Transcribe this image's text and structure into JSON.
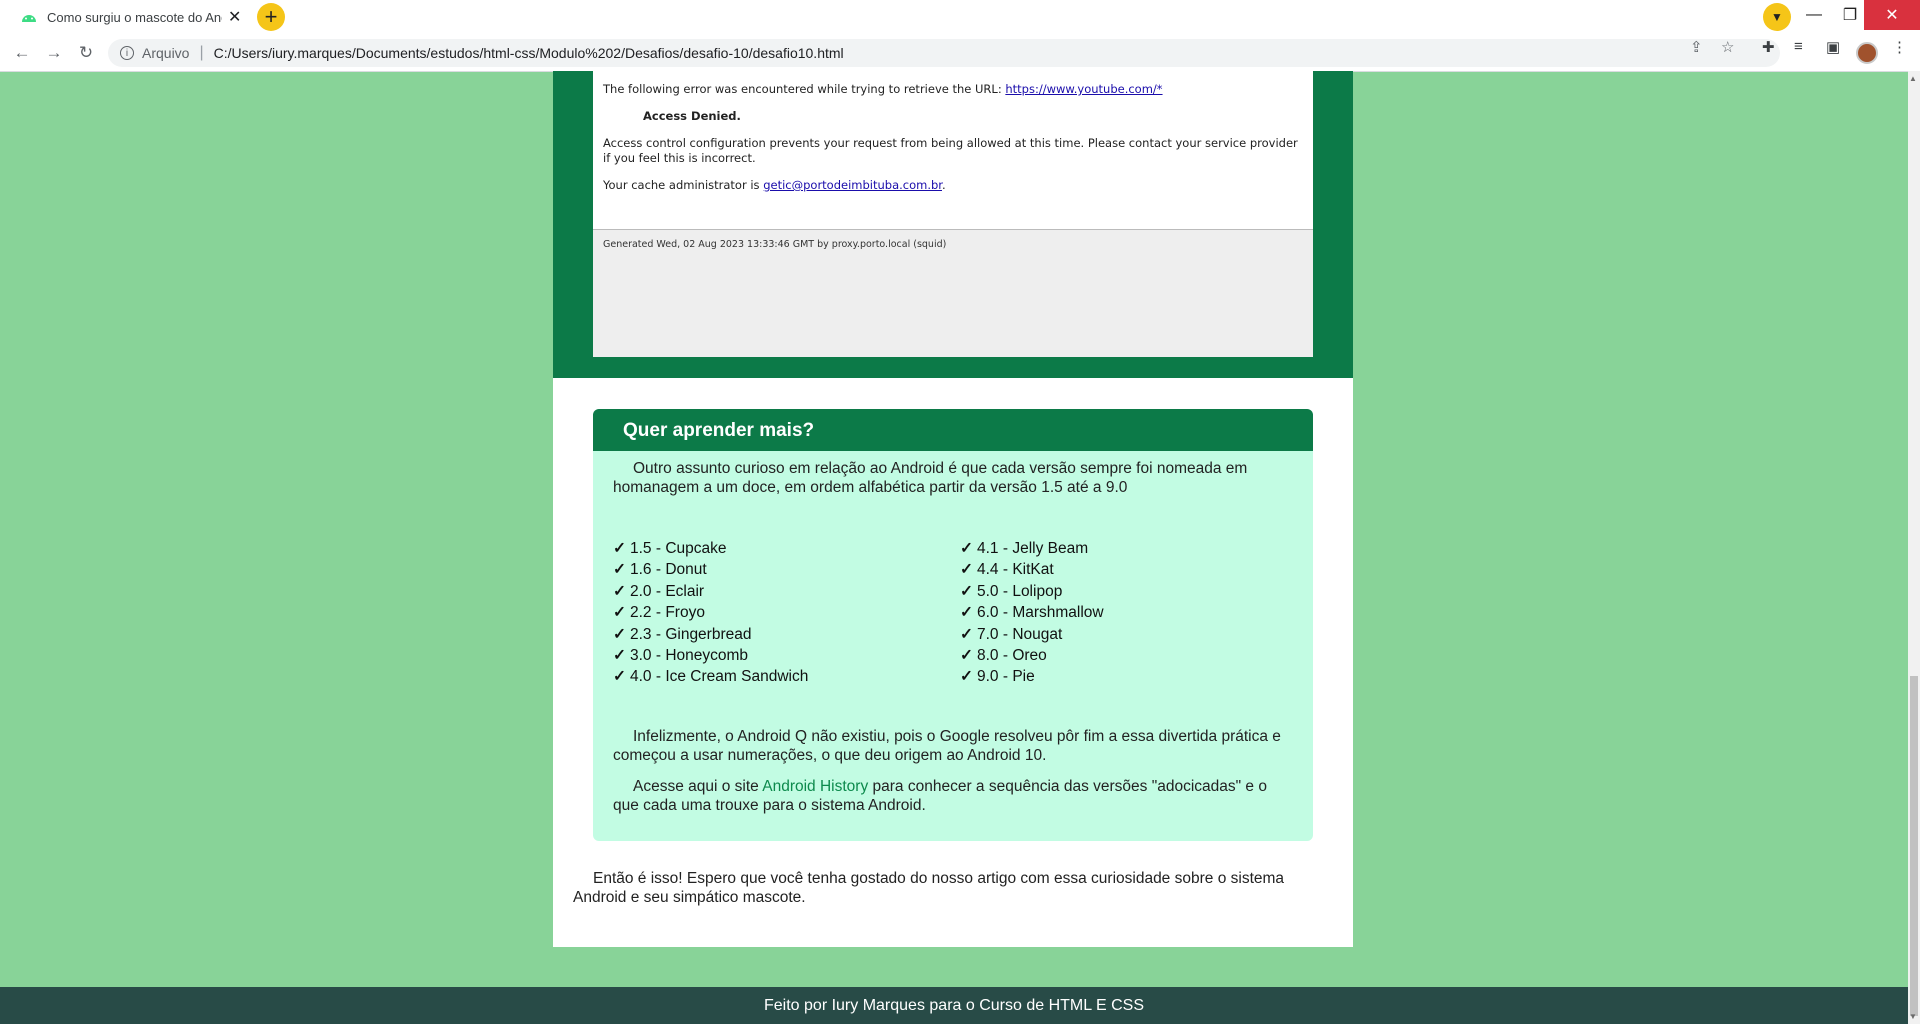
{
  "browser": {
    "tab_title": "Como surgiu o mascote do Andr",
    "tab_close": "✕",
    "new_tab": "+",
    "omnibox_label": "Arquivo",
    "url": "C:/Users/iury.marques/Documents/estudos/html-css/Modulo%202/Desafios/desafio-10/desafio10.html",
    "window_min": "—",
    "window_restore": "❐",
    "window_close": "✕"
  },
  "error_page": {
    "line1_text": "The following error was encountered while trying to retrieve the URL: ",
    "line1_link": "https://www.youtube.com/*",
    "access_denied": "Access Denied.",
    "line2": "Access control configuration prevents your request from being allowed at this time. Please contact your service provider if you feel this is incorrect.",
    "line3_text": "Your cache administrator is ",
    "line3_link": "getic@portodeimbituba.com.br",
    "line3_end": ".",
    "generated": "Generated Wed, 02 Aug 2023 13:33:46 GMT by proxy.porto.local (squid)"
  },
  "card": {
    "heading": "Quer aprender mais?",
    "intro": "Outro assunto curioso em relação ao Android é que cada versão sempre foi nomeada em homanagem a um doce, em ordem alfabética partir da versão 1.5 até a 9.0",
    "check": "✓",
    "versions_left": [
      "1.5 - Cupcake",
      "1.6 - Donut",
      "2.0 - Eclair",
      "2.2 - Froyo",
      "2.3 - Gingerbread",
      "3.0 - Honeycomb",
      "4.0 - Ice Cream Sandwich"
    ],
    "versions_right": [
      "4.1 - Jelly Beam",
      "4.4 - KitKat",
      "5.0 - Lolipop",
      "6.0 - Marshmallow",
      "7.0 - Nougat",
      "8.0 - Oreo",
      "9.0 - Pie"
    ],
    "para2": "Infelizmente, o Android Q não existiu, pois o Google resolveu pôr fim a essa divertida prática e começou a usar numerações, o que deu origem ao Android 10.",
    "para3_before": "Acesse aqui o site ",
    "para3_link": "Android History",
    "para3_after": " para conhecer a sequência das versões \"adocicadas\" e o que cada uma trouxe para o sistema Android."
  },
  "outro": "Então é isso! Espero que você tenha gostado do nosso artigo com essa curiosidade sobre o sistema Android e seu simpático mascote.",
  "footer": "Feito por Iury Marques para o Curso de HTML E CSS",
  "colors": {
    "page_bg": "#88d398",
    "brand_green": "#0c7a48",
    "card_bg": "#c2fce3",
    "footer_bg": "#284b47"
  }
}
